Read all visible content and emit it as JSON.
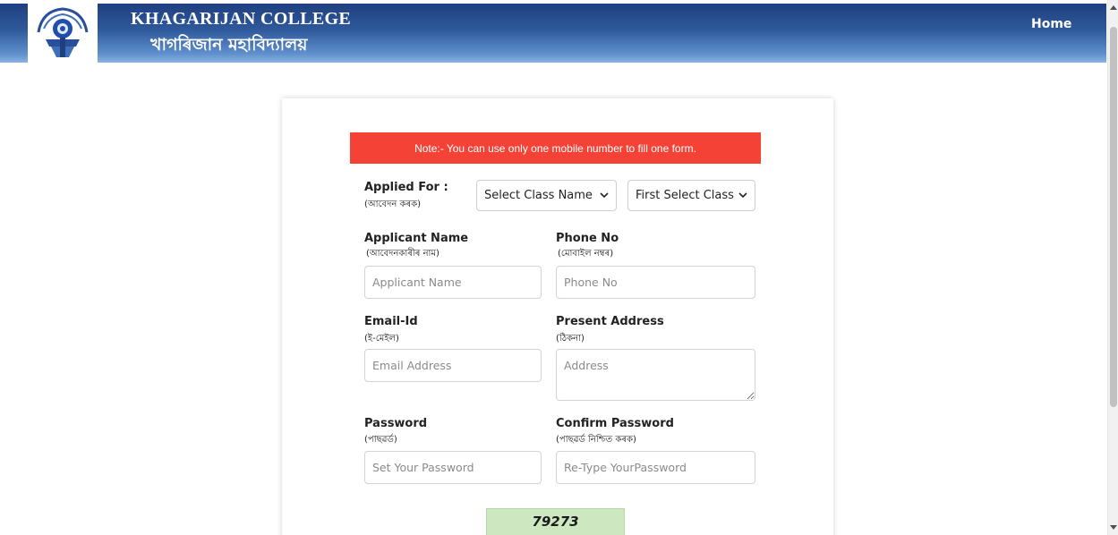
{
  "header": {
    "college_name": "KHAGARIJAN COLLEGE",
    "college_name_bn": "খাগৰিজান মহাবিদ্যালয়",
    "home_link": "Home",
    "colors": {
      "header_top": "#1f3f7e",
      "header_bottom": "#8ab3e3"
    }
  },
  "form": {
    "note": "Note:- You can use only one mobile number to fill one form.",
    "note_color": "#f44336",
    "applied_for": {
      "label": "Applied For :",
      "sub": "(আবেদন কৰক)",
      "class_select": "Select Class Name",
      "second_select": "First Select Class"
    },
    "applicant_name": {
      "label": "Applicant Name",
      "sub": "(আবেদনকাৰীৰ নাম)",
      "placeholder": "Applicant Name"
    },
    "phone": {
      "label": "Phone No",
      "sub": "(মোবাইল নম্বৰ)",
      "placeholder": "Phone No"
    },
    "email": {
      "label": "Email-Id",
      "sub": "(ই-মেইল)",
      "placeholder": "Email Address"
    },
    "address": {
      "label": "Present Address",
      "sub": "(ঠিকনা)",
      "placeholder": "Address"
    },
    "password": {
      "label": "Password",
      "sub": "(পাছৱৰ্ড)",
      "placeholder": "Set Your Password"
    },
    "confirm_password": {
      "label": "Confirm Password",
      "sub": "(পাছৱৰ্ড নিশ্চিত কৰক)",
      "placeholder": "Re-Type YourPassword"
    },
    "captcha": "79273"
  }
}
